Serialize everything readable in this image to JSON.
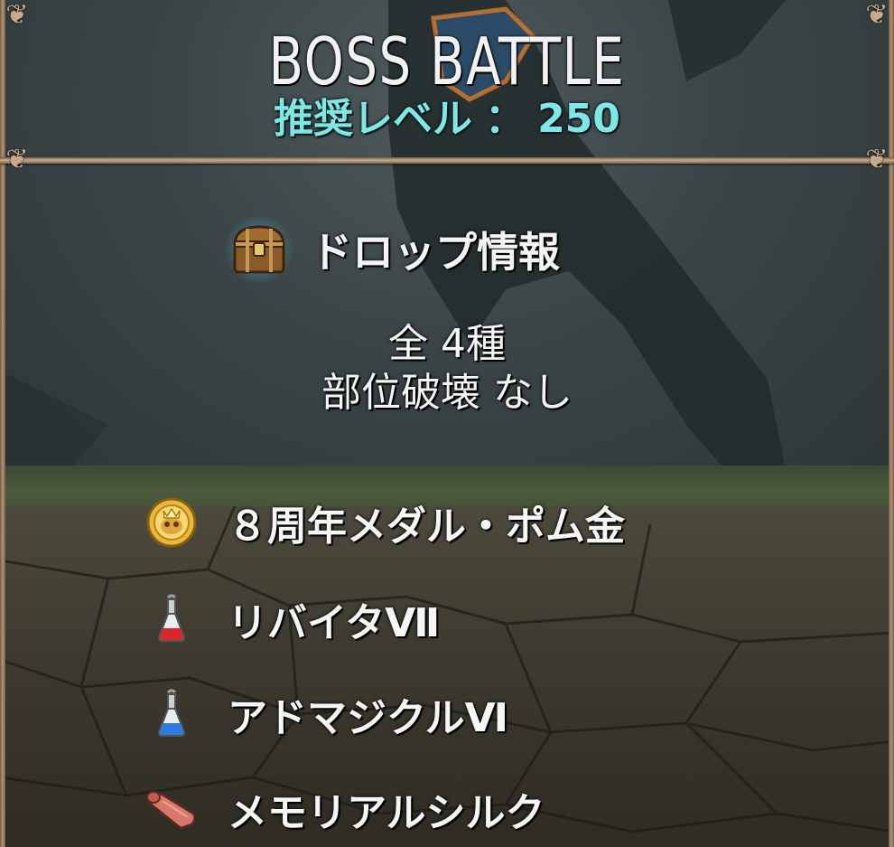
{
  "header": {
    "title": "BOSS BATTLE",
    "level_label": "推奨レベル",
    "level_separator": "：",
    "level_value": "250"
  },
  "drop": {
    "title": "ドロップ情報",
    "count_text": "全 4種",
    "break_text": "部位破壊 なし",
    "icon": "treasure-chest-icon"
  },
  "items": [
    {
      "label": "８周年メダル・ポム金",
      "icon": "gold-medal-icon"
    },
    {
      "label": "リバイタⅦ",
      "icon": "red-potion-icon"
    },
    {
      "label": "アドマジクルⅥ",
      "icon": "blue-potion-icon"
    },
    {
      "label": "メモリアルシルク",
      "icon": "silk-cloth-icon"
    }
  ],
  "colors": {
    "title": "#f2f2f2",
    "level": "#7fe7e6",
    "frame": "#caa98a"
  }
}
